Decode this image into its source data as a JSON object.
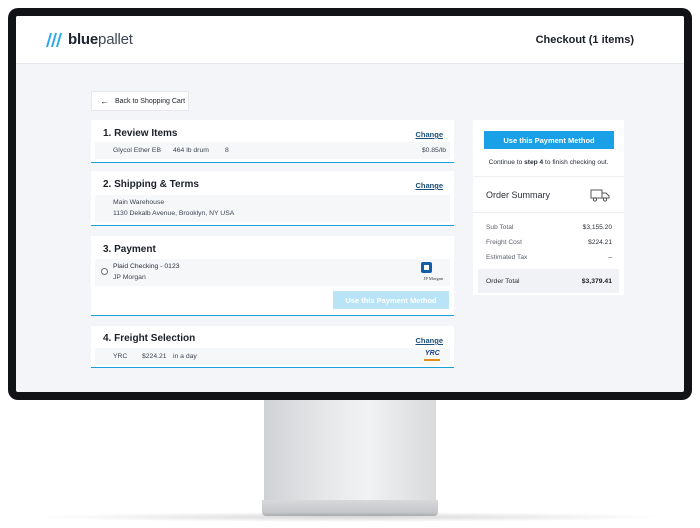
{
  "header": {
    "logo_bold": "blue",
    "logo_rest": "pallet",
    "checkout_title": "Checkout (1 items)"
  },
  "back_button": {
    "label": "Back to Shopping Cart"
  },
  "review": {
    "title": "1. Review Items",
    "change": "Change",
    "item": {
      "name": "Glycol Ether EB",
      "package": "464 lb drum",
      "qty": "8",
      "price": "$0.85/lb"
    }
  },
  "shipping": {
    "title": "2. Shipping & Terms",
    "change": "Change",
    "location": "Main Warehouse",
    "address": "1130 Dekalb Avenue, Brooklyn, NY USA"
  },
  "payment": {
    "title": "3. Payment",
    "account": "Plaid Checking - 0123",
    "bank": "JP Morgan",
    "bank_logo_text": "JP Morgan",
    "button": "Use this Payment Method"
  },
  "freight": {
    "title": "4. Freight Selection",
    "change": "Change",
    "carrier": "YRC",
    "cost": "$224.21",
    "eta": "in a day",
    "carrier_logo_text": "YRC"
  },
  "summary": {
    "button": "Use this Payment Method",
    "continue_pre": "Continue to ",
    "continue_step": "step 4",
    "continue_post": " to finish checking out.",
    "title": "Order Summary",
    "rows": [
      {
        "label": "Sub Total",
        "value": "$3,155.20"
      },
      {
        "label": "Freight Cost",
        "value": "$224.21"
      },
      {
        "label": "Estimated Tax",
        "value": "–"
      }
    ],
    "total_label": "Order Total",
    "total_value": "$3,379.41"
  },
  "colors": {
    "accent": "#1aa0e6",
    "link": "#1d4f7a",
    "underline": "#1aa0d9"
  },
  "icons": [
    "bluepallet-logo-icon",
    "arrow-left-icon",
    "radio-icon",
    "chase-logo-icon",
    "yrc-logo-icon",
    "truck-icon"
  ]
}
